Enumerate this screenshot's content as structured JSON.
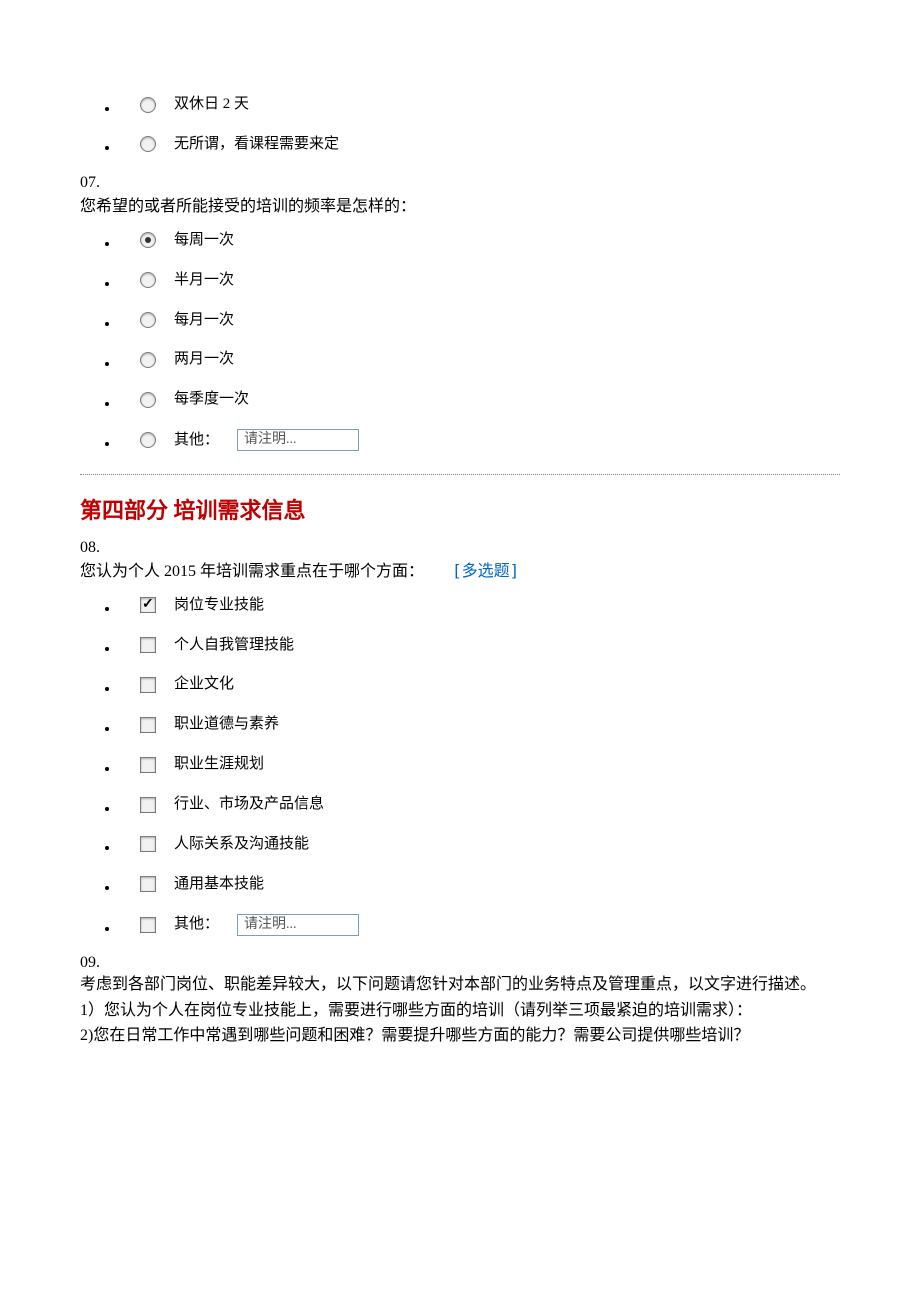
{
  "q06_tail_options": [
    {
      "label": "双休日 2 天",
      "checked": false
    },
    {
      "label": "无所谓，看课程需要来定",
      "checked": false
    }
  ],
  "q07": {
    "number": "07.",
    "text": "您希望的或者所能接受的培训的频率是怎样的：",
    "options": [
      {
        "label": "每周一次",
        "checked": true
      },
      {
        "label": "半月一次",
        "checked": false
      },
      {
        "label": "每月一次",
        "checked": false
      },
      {
        "label": "两月一次",
        "checked": false
      },
      {
        "label": "每季度一次",
        "checked": false
      }
    ],
    "other_label": "其他：",
    "other_placeholder": "请注明..."
  },
  "section4_title": "第四部分  培训需求信息",
  "q08": {
    "number": "08.",
    "text": "您认为个人 2015 年培训需求重点在于哪个方面：",
    "hint": "[多选题]",
    "options": [
      {
        "label": "岗位专业技能",
        "checked": true
      },
      {
        "label": "个人自我管理技能",
        "checked": false
      },
      {
        "label": "企业文化",
        "checked": false
      },
      {
        "label": "职业道德与素养",
        "checked": false
      },
      {
        "label": "职业生涯规划",
        "checked": false
      },
      {
        "label": "行业、市场及产品信息",
        "checked": false
      },
      {
        "label": "人际关系及沟通技能",
        "checked": false
      },
      {
        "label": "通用基本技能",
        "checked": false
      }
    ],
    "other_label": "其他：",
    "other_placeholder": "请注明..."
  },
  "q09": {
    "number": "09.",
    "line1": "考虑到各部门岗位、职能差异较大，以下问题请您针对本部门的业务特点及管理重点，以文字进行描述。",
    "line2": "1）您认为个人在岗位专业技能上，需要进行哪些方面的培训（请列举三项最紧迫的培训需求）：",
    "line3": "2)您在日常工作中常遇到哪些问题和困难？需要提升哪些方面的能力？需要公司提供哪些培训？"
  }
}
